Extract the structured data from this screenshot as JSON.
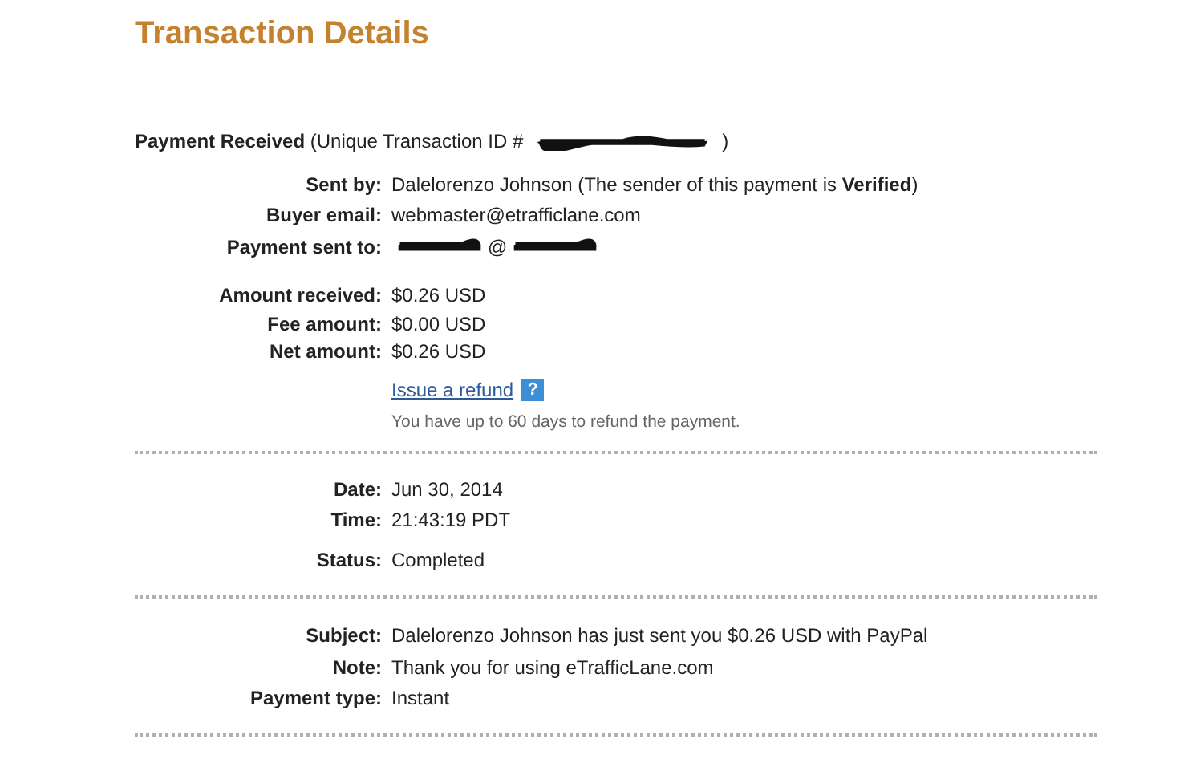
{
  "title": "Transaction Details",
  "payment_heading": {
    "text": "**Payment Received** (Unique Transaction ID #",
    "suffix": ")",
    "id_redacted": true
  },
  "sections": [
    {
      "groups": [
        [
          {
            "label": "Sent by:",
            "value": "Dalelorenzo Johnson (The sender of this payment is **Verified**)"
          },
          {
            "label": "Buyer email:",
            "value": "webmaster@etrafficlane.com"
          },
          {
            "label": "Payment sent to:",
            "value_parts": [
              {
                "kind": "redacted"
              },
              {
                "kind": "text",
                "text": "@"
              },
              {
                "kind": "redacted"
              }
            ]
          }
        ],
        [
          {
            "label": "Amount received:",
            "value": "$0.26 USD"
          },
          {
            "label": "Fee amount:",
            "value": "$0.00 USD"
          },
          {
            "label": "Net amount:",
            "value": "$0.26 USD"
          }
        ]
      ],
      "refund": {
        "link": "Issue a refund",
        "help": "?",
        "note": "You have up to 60 days to refund the payment."
      }
    },
    {
      "groups": [
        [
          {
            "label": "Date:",
            "value": "Jun 30, 2014"
          },
          {
            "label": "Time:",
            "value": "21:43:19 PDT"
          }
        ],
        [
          {
            "label": "Status:",
            "value": "Completed"
          }
        ]
      ]
    },
    {
      "groups": [
        [
          {
            "label": "Subject:",
            "value": "Dalelorenzo Johnson has just sent you $0.26 USD with PayPal"
          },
          {
            "label": "Note:",
            "value": "Thank you for using eTrafficLane.com"
          },
          {
            "label": "Payment type:",
            "value": "Instant"
          }
        ]
      ]
    }
  ]
}
